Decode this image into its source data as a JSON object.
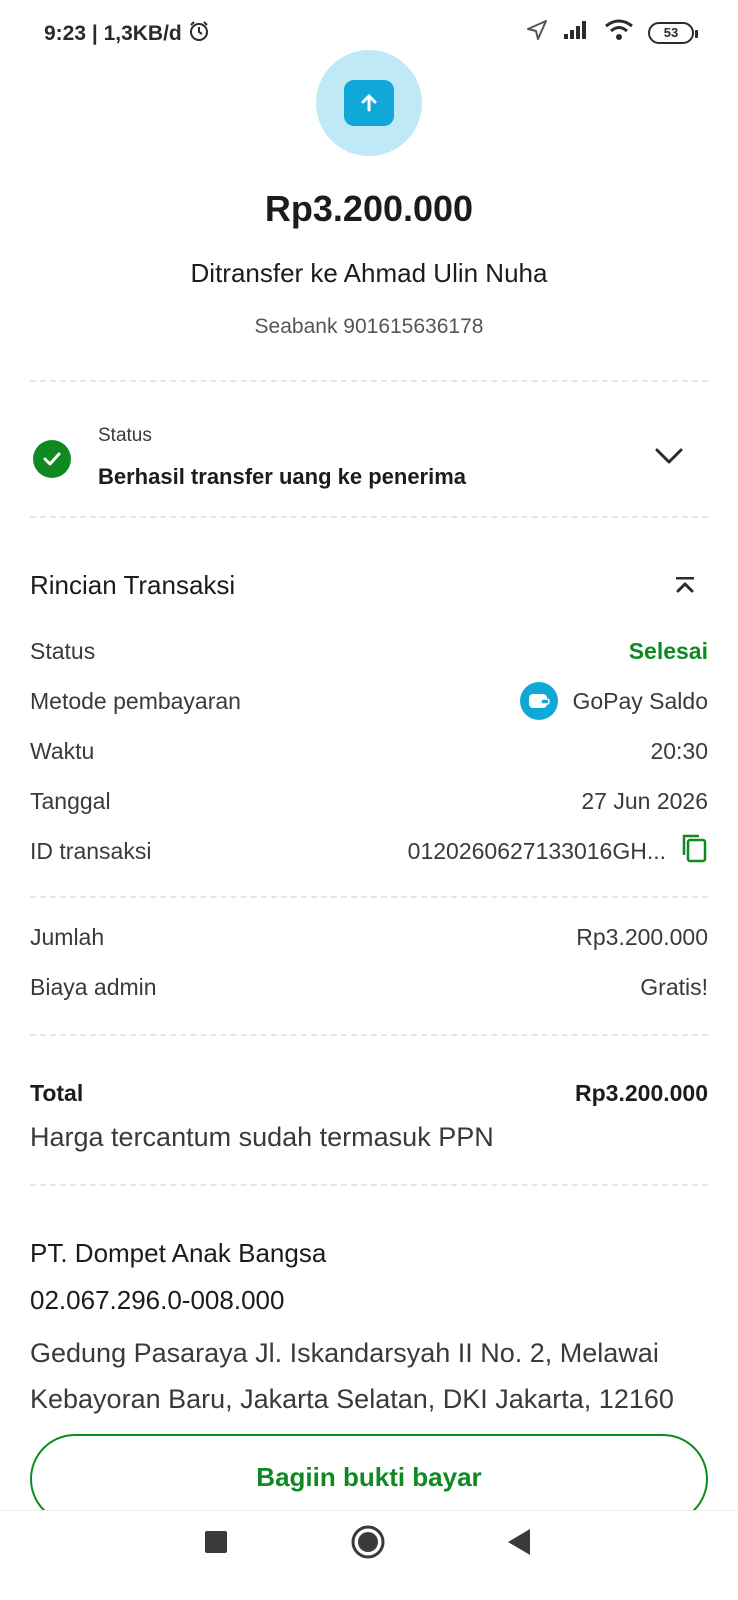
{
  "status_bar": {
    "time_info": "9:23 | 1,3KB/d",
    "battery": "53"
  },
  "hero": {
    "amount": "Rp3.200.000",
    "recipient": "Ditransfer ke Ahmad Ulin Nuha",
    "bank": "Seabank 901615636178"
  },
  "status_card": {
    "label": "Status",
    "value": "Berhasil transfer uang ke penerima"
  },
  "details": {
    "title": "Rincian Transaksi",
    "rows": [
      {
        "label": "Status",
        "value": "Selesai"
      },
      {
        "label": "Metode pembayaran",
        "value": "GoPay Saldo"
      },
      {
        "label": "Waktu",
        "value": "20:30"
      },
      {
        "label": "Tanggal",
        "value": "27 Jun 2026"
      },
      {
        "label": "ID transaksi",
        "value": "0120260627133016GH..."
      }
    ],
    "fees": [
      {
        "label": "Jumlah",
        "value": "Rp3.200.000"
      },
      {
        "label": "Biaya admin",
        "value": "Gratis!"
      }
    ],
    "total_label": "Total",
    "total_value": "Rp3.200.000",
    "tax_note": "Harga tercantum sudah termasuk PPN"
  },
  "company": {
    "name": "PT. Dompet Anak Bangsa",
    "npwp": "02.067.296.0-008.000",
    "address_line1": "Gedung Pasaraya Jl. Iskandarsyah II No. 2, Melawai",
    "address_line2": "Kebayoran Baru, Jakarta Selatan, DKI Jakarta, 12160"
  },
  "share_button": "Bagiin bukti bayar",
  "colors": {
    "success_green": "#0f8a23",
    "gopay_blue": "#10a8d6",
    "hero_bg": "#bfe9f6"
  }
}
